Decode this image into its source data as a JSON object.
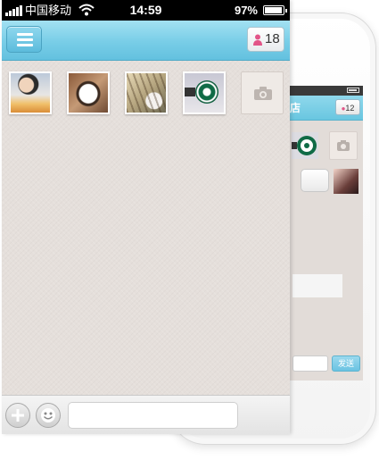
{
  "status_bar": {
    "carrier": "中国移动",
    "time": "14:59",
    "battery": "97%"
  },
  "header": {
    "member_count": "18"
  },
  "photos": [
    {
      "icon": "photo-child"
    },
    {
      "icon": "photo-coffee"
    },
    {
      "icon": "photo-cafe"
    },
    {
      "icon": "photo-starbucks"
    }
  ],
  "composer": {
    "input_value": ""
  },
  "background_phone": {
    "title_fragment": "店",
    "member_count": "12",
    "send_label": "发送"
  },
  "colors": {
    "nav_blue": "#78cde7",
    "chat_bg": "#e5dfdb",
    "person_pink": "#e25588"
  }
}
